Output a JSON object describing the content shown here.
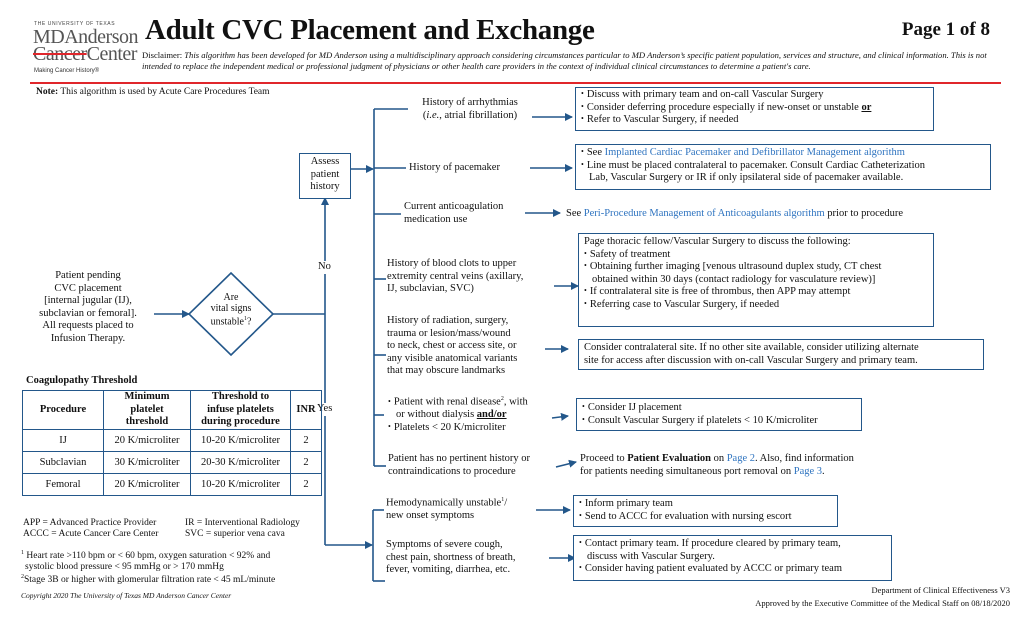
{
  "header": {
    "logo": {
      "line1": "THE UNIVERSITY OF TEXAS",
      "line2": "MDAnderson",
      "line3a": "Cancer",
      "line3b": "Center",
      "tagline": "Making Cancer History®"
    },
    "title": "Adult CVC Placement and Exchange",
    "page": "Page 1 of 8",
    "disclaimer_label": "Disclaimer:",
    "disclaimer_text": "This algorithm has been developed for MD Anderson using a multidisciplinary approach considering circumstances particular to MD Anderson’s specific patient population, services and structure, and clinical information. This is not intended to replace the independent medical or professional judgment of physicians or other health care providers in the context of individual clinical circumstances to determine a patient's care.",
    "accent_color": "#e0262b"
  },
  "note": {
    "label": "Note:",
    "text": "This algorithm is used by Acute Care Procedures Team"
  },
  "flow": {
    "start": [
      "Patient pending",
      "CVC placement",
      "[internal jugular (IJ),",
      "subclavian or femoral].",
      "All requests placed to",
      "Infusion Therapy."
    ],
    "decision": {
      "line1": "Are",
      "line2": "vital signs",
      "line3": "unstable",
      "sup": "1",
      "tail": "?"
    },
    "no_label": "No",
    "yes_label": "Yes",
    "assess": [
      "Assess",
      "patient",
      "history"
    ],
    "history_items": [
      {
        "label": [
          "History of arrhythmias",
          "(i.e., atrial fibrillation)"
        ],
        "actions": [
          "Discuss with primary team and on-call Vascular Surgery",
          "Consider deferring procedure especially if new-onset or unstable",
          "Refer to Vascular Surgery, if needed"
        ],
        "actions_or": "or"
      },
      {
        "label": [
          "History of pacemaker"
        ],
        "action_see": "See",
        "action_link": "Implanted Cardiac Pacemaker and Defibrillator Management algorithm",
        "action2": [
          "Line must be placed contralateral to pacemaker. Consult Cardiac Catheterization",
          "Lab, Vascular Surgery or IR if only ipsilateral side of pacemaker available."
        ]
      },
      {
        "label": [
          "Current anticoagulation",
          "medication use"
        ],
        "pre": "See",
        "link": "Peri-Procedure Management of Anticoagulants algorithm",
        "post": "prior to procedure"
      },
      {
        "label": [
          "History of blood clots to upper",
          "extremity central veins (axillary,",
          "IJ, subclavian, SVC)"
        ],
        "intro": "Page thoracic fellow/Vascular Surgery to discuss the following:",
        "actions": [
          "Safety of treatment",
          "Obtaining further imaging [venous ultrasound duplex study, CT chest",
          "obtained within 30 days (contact radiology for vasculature review)]",
          "If contralateral site is free of thrombus, then APP may attempt",
          "Referring case to Vascular Surgery, if needed"
        ]
      },
      {
        "label": [
          "History of radiation, surgery,",
          "trauma or lesion/mass/wound",
          "to neck, chest or access site, or",
          "any visible anatomical variants",
          "that may obscure landmarks"
        ],
        "action": [
          "Consider contralateral site. If no other site available, consider utilizing alternate",
          "site for access after discussion with on-call Vascular Surgery and primary team."
        ]
      },
      {
        "label_b1": "Patient with renal disease",
        "label_sup": "2",
        "label_b1_tail": ", with",
        "label_b1_l2": "or without dialysis",
        "label_andor": "and/or",
        "label_b2": "Platelets < 20 K/microliter",
        "actions": [
          "Consider IJ placement",
          "Consult Vascular Surgery if platelets < 10 K/microliter"
        ]
      },
      {
        "label": [
          "Patient has no pertinent history or",
          "contraindications to procedure"
        ],
        "pre": "Proceed to",
        "bold": "Patient Evaluation",
        "on": "on",
        "link1": "Page 2",
        "mid": ". Also, find information",
        "line2": "for patients needing simultaneous port removal on",
        "link2": "Page 3",
        "end": "."
      }
    ],
    "yes_items": [
      {
        "label": "Hemodynamically unstable",
        "sup": "1",
        "label_tail": "/",
        "label2": "new onset symptoms",
        "actions": [
          "Inform primary team",
          "Send to ACCC for evaluation with nursing escort"
        ]
      },
      {
        "label": [
          "Symptoms of severe cough,",
          "chest pain, shortness of breath,",
          "fever, vomiting, diarrhea, etc."
        ],
        "actions": [
          "Contact primary team. If procedure cleared by primary team,",
          "discuss with Vascular Surgery.",
          "Consider having patient evaluated by ACCC or primary team"
        ]
      }
    ]
  },
  "coag_table": {
    "title": "Coagulopathy Threshold",
    "headers": [
      [
        "Procedure"
      ],
      [
        "Minimum",
        "platelet",
        "threshold"
      ],
      [
        "Threshold to",
        "infuse platelets",
        "during procedure"
      ],
      [
        "INR"
      ]
    ],
    "rows": [
      [
        "IJ",
        "20 K/microliter",
        "10-20 K/microliter",
        "2"
      ],
      [
        "Subclavian",
        "30 K/microliter",
        "20-30 K/microliter",
        "2"
      ],
      [
        "Femoral",
        "20 K/microliter",
        "10-20 K/microliter",
        "2"
      ]
    ]
  },
  "abbreviations": [
    "APP = Advanced Practice Provider",
    "IR = Interventional Radiology",
    "ACCC = Acute Cancer Care Center",
    "SVC = superior vena cava"
  ],
  "footnotes": [
    {
      "num": "1",
      "text": "Heart rate >110 bpm or < 60 bpm, oxygen saturation < 92% and",
      "text2": "systolic blood pressure < 95 mmHg or > 170 mmHg"
    },
    {
      "num": "2",
      "text": "Stage 3B or higher with glomerular filtration rate < 45 mL/minute"
    }
  ],
  "copyright": "Copyright 2020 The University of Texas MD Anderson Cancer Center",
  "footer": {
    "dept": "Department of Clinical Effectiveness V3",
    "approved": "Approved by the Executive Committee of the Medical Staff on 08/18/2020"
  },
  "colors": {
    "line": "#23578a",
    "link": "#2f74c0"
  }
}
